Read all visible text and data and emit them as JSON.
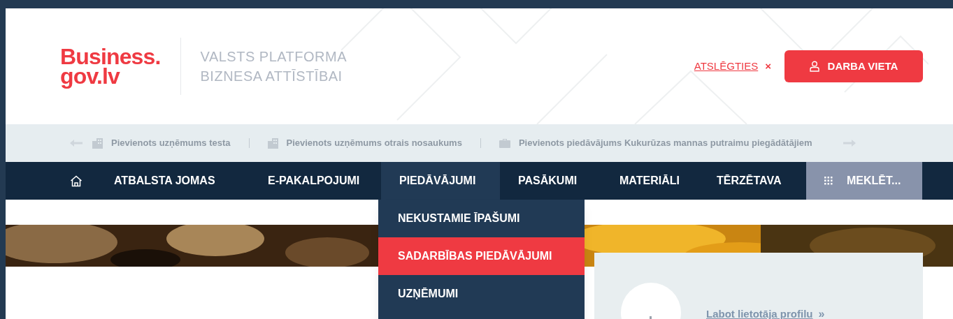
{
  "logo": {
    "line_1": "Business.",
    "line_2": "gov.lv"
  },
  "tagline": {
    "line_1": "VALSTS PLATFORMA",
    "line_2": "BIZNESA ATTĪSTĪBAI"
  },
  "header_actions": {
    "logout_link": "ATSLĒGTIES",
    "close": "×",
    "workplace_button": "DARBA VIETA"
  },
  "ticker": [
    {
      "kind": "company",
      "text": "Pievienots uzņēmums testa"
    },
    {
      "kind": "company",
      "text": "Pievienots uzņēmums otrais nosaukums"
    },
    {
      "kind": "offer",
      "text": "Pievienots piedāvājums Kukurūzas mannas putraimu piegādātājiem"
    }
  ],
  "nav": {
    "items": [
      {
        "label": "ATBALSTA JOMAS",
        "selected": false
      },
      {
        "label": "E-PAKALPOJUMI",
        "selected": false
      },
      {
        "label": "PIEDĀVĀJUMI",
        "selected": true
      },
      {
        "label": "PASĀKUMI",
        "selected": false
      },
      {
        "label": "MATERIĀLI",
        "selected": false
      },
      {
        "label": "TĒRZĒTAVA",
        "selected": false
      }
    ],
    "search": "MEKLĒT..."
  },
  "dropdown": [
    {
      "label": "NEKUSTAMIE ĪPAŠUMI",
      "selected": false
    },
    {
      "label": "SADARBĪBAS PIEDĀVĀJUMI",
      "selected": true
    },
    {
      "label": "UZŅĒMUMI",
      "selected": false
    }
  ],
  "profile_card": {
    "link": "Labot lietotāja profilu",
    "chevron": "»"
  }
}
